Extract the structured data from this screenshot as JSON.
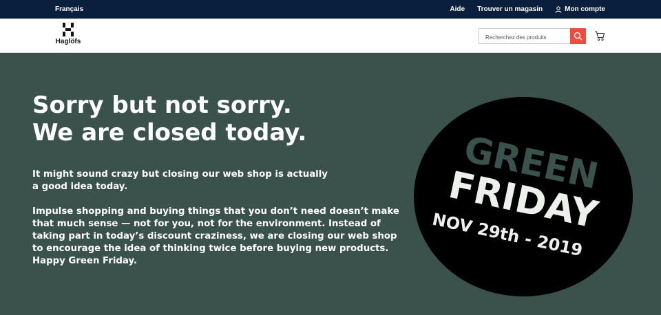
{
  "topbar": {
    "language": "Français",
    "help": "Aide",
    "find_store": "Trouver un magasin",
    "account": "Mon compte"
  },
  "header": {
    "brand": "Haglöfs",
    "search_placeholder": "Recherchez des produits"
  },
  "hero": {
    "headline_line1": "Sorry but not sorry.",
    "headline_line2": "We are closed today.",
    "paragraph1": "It might sound crazy but closing our web shop is actually a good idea today.",
    "paragraph2": "Impulse shopping and buying things that you don’t need doesn’t make that much sense — not for you, not for the environment. Instead of taking part in today’s discount craziness, we are closing our web shop to encourage the idea of thinking twice before buying new products. Happy Green Friday."
  },
  "badge": {
    "word1": "GREEN",
    "word2": "FRIDAY",
    "date": "NOV 29th - 2019"
  },
  "colors": {
    "topbar_bg": "#0a1f3d",
    "hero_bg": "#3b514b",
    "search_button": "#f04b3e",
    "badge_green_text": "#3b514b"
  }
}
